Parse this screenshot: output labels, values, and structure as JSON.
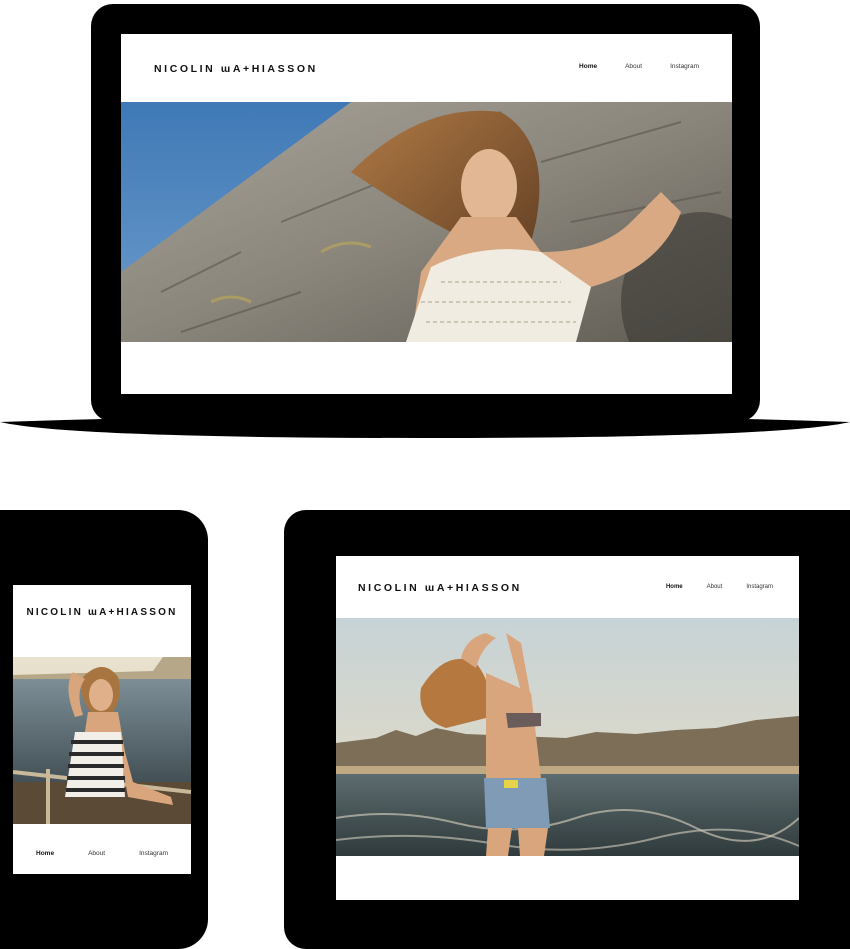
{
  "site": {
    "logo_text": "NICOLIN ɯA+HIASSON",
    "nav": {
      "home": "Home",
      "about": "About",
      "instagram": "Instagram"
    }
  },
  "devices": {
    "laptop": {
      "hero_image": "model-against-rock-wall"
    },
    "phone": {
      "hero_image": "model-at-beach-railing"
    },
    "tablet": {
      "hero_image": "model-in-shallow-surf"
    }
  },
  "colors": {
    "frame": "#000000",
    "screen_bg": "#ffffff",
    "logo": "#111111",
    "sky": "#4f86bd",
    "rock": "#8e8a80"
  }
}
